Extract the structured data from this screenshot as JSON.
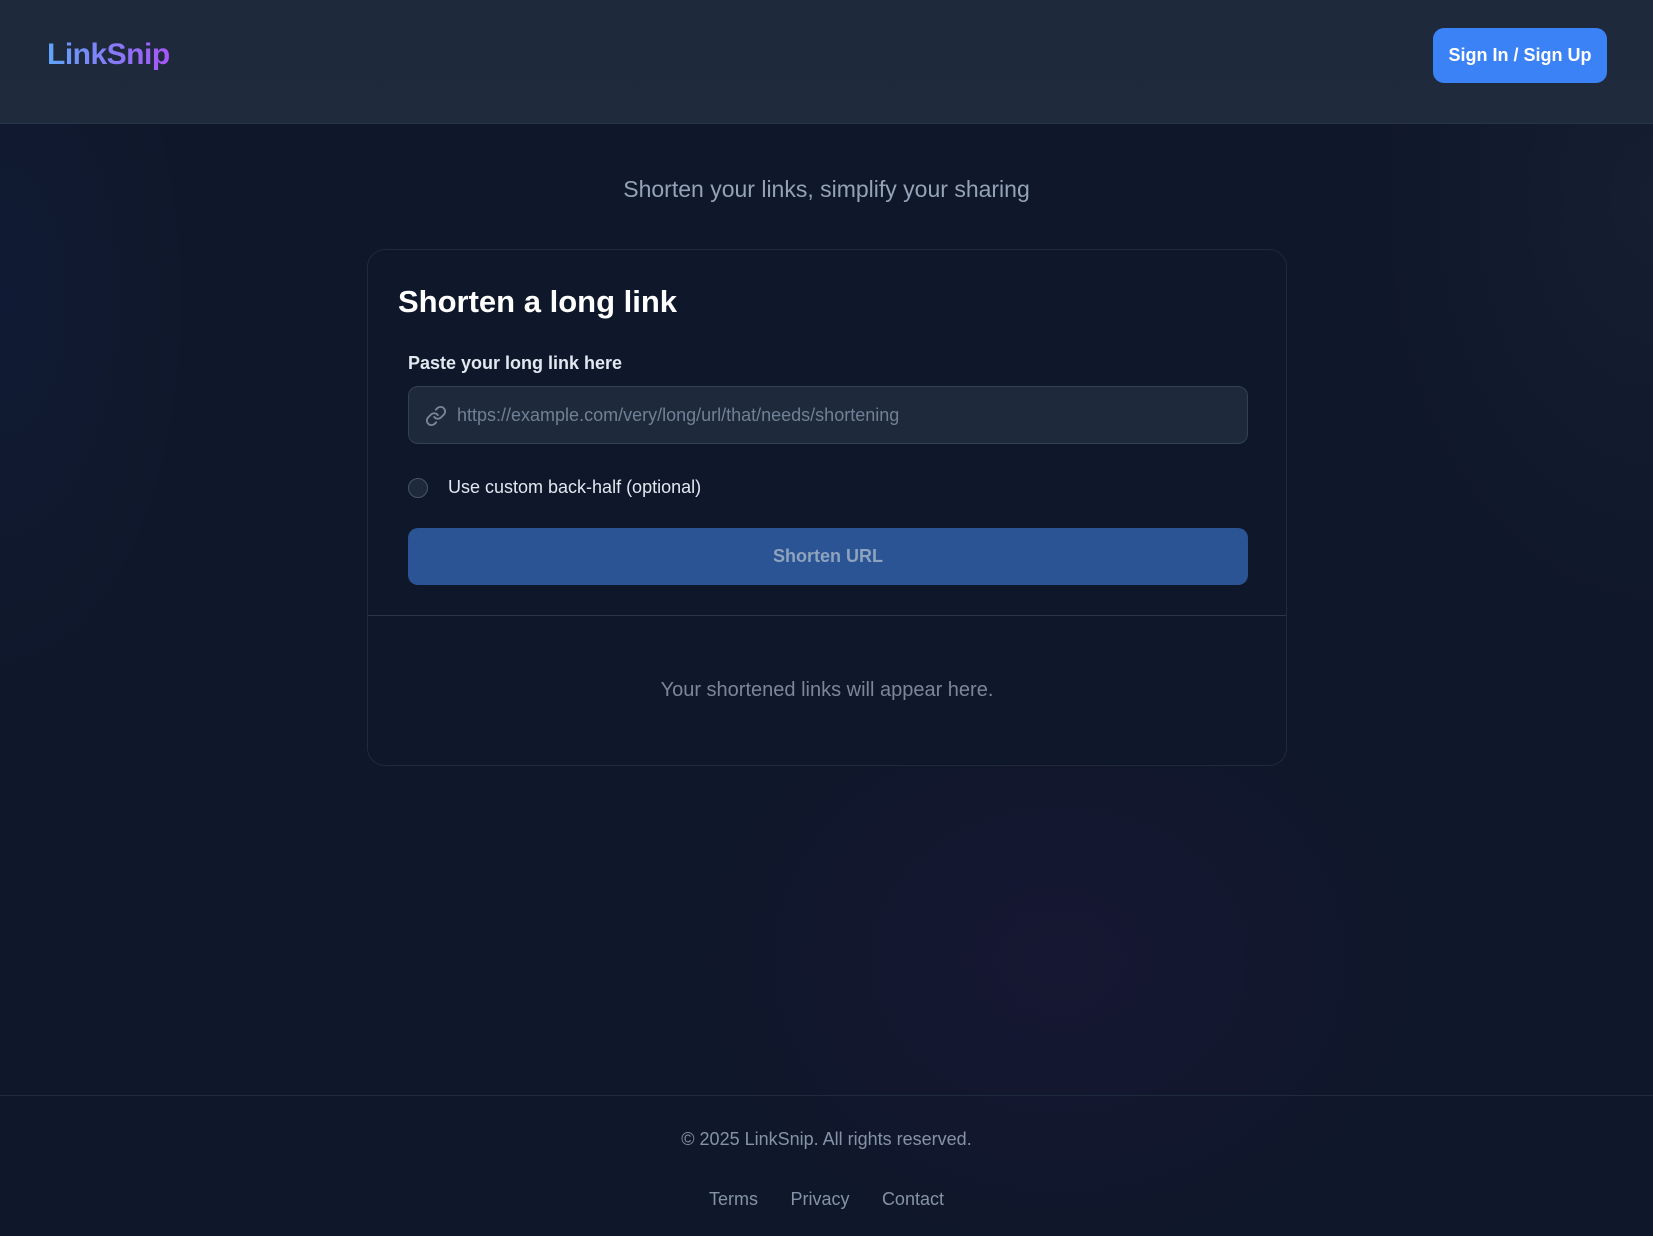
{
  "header": {
    "logo": "LinkSnip",
    "signin_label": "Sign In / Sign Up"
  },
  "hero": {
    "tagline": "Shorten your links, simplify your sharing"
  },
  "card": {
    "title": "Shorten a long link",
    "field_label": "Paste your long link here",
    "url_value": "",
    "url_placeholder": "https://example.com/very/long/url/that/needs/shortening",
    "link_icon": "link-icon",
    "custom_label": "Use custom back-half (optional)",
    "custom_checked": false,
    "shorten_label": "Shorten URL",
    "empty_state": "Your shortened links will appear here."
  },
  "footer": {
    "copyright": "© 2025 LinkSnip. All rights reserved.",
    "links": [
      "Terms",
      "Privacy",
      "Contact"
    ]
  },
  "colors": {
    "background": "#0f172a",
    "header_bg": "#1e293b",
    "primary": "#3b82f6",
    "primary_disabled": "#2a5494",
    "logo_gradient_start": "#60a5fa",
    "logo_gradient_end": "#a855f7"
  }
}
